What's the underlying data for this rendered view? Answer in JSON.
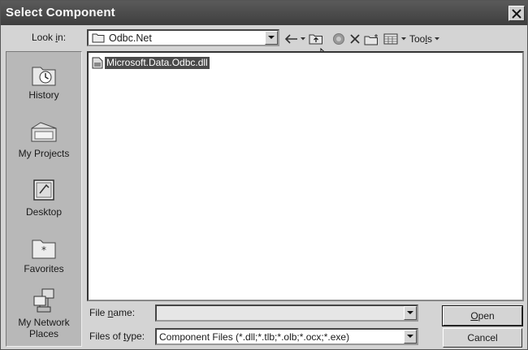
{
  "window": {
    "title": "Select Component"
  },
  "look_in": {
    "label_pre": "Look ",
    "label_key": "i",
    "label_post": "n:",
    "value": "Odbc.Net"
  },
  "toolbar": {
    "tools_pre": "Too",
    "tools_key": "l",
    "tools_post": "s"
  },
  "places": [
    {
      "label": "History",
      "icon": "history-icon"
    },
    {
      "label": "My Projects",
      "icon": "my-projects-icon"
    },
    {
      "label": "Desktop",
      "icon": "desktop-icon"
    },
    {
      "label": "Favorites",
      "icon": "favorites-icon"
    },
    {
      "label_line1": "My Network",
      "label_line2": "Places",
      "icon": "network-places-icon"
    }
  ],
  "files": [
    {
      "name": "Microsoft.Data.Odbc.dll",
      "selected": true
    }
  ],
  "file_name": {
    "label_pre": "File ",
    "label_key": "n",
    "label_post": "ame:",
    "value": ""
  },
  "file_type": {
    "label_pre": "Files of ",
    "label_key": "t",
    "label_post": "ype:",
    "value": "Component Files (*.dll;*.tlb;*.olb;*.ocx;*.exe)"
  },
  "buttons": {
    "open_key": "O",
    "open_post": "pen",
    "cancel": "Cancel"
  }
}
